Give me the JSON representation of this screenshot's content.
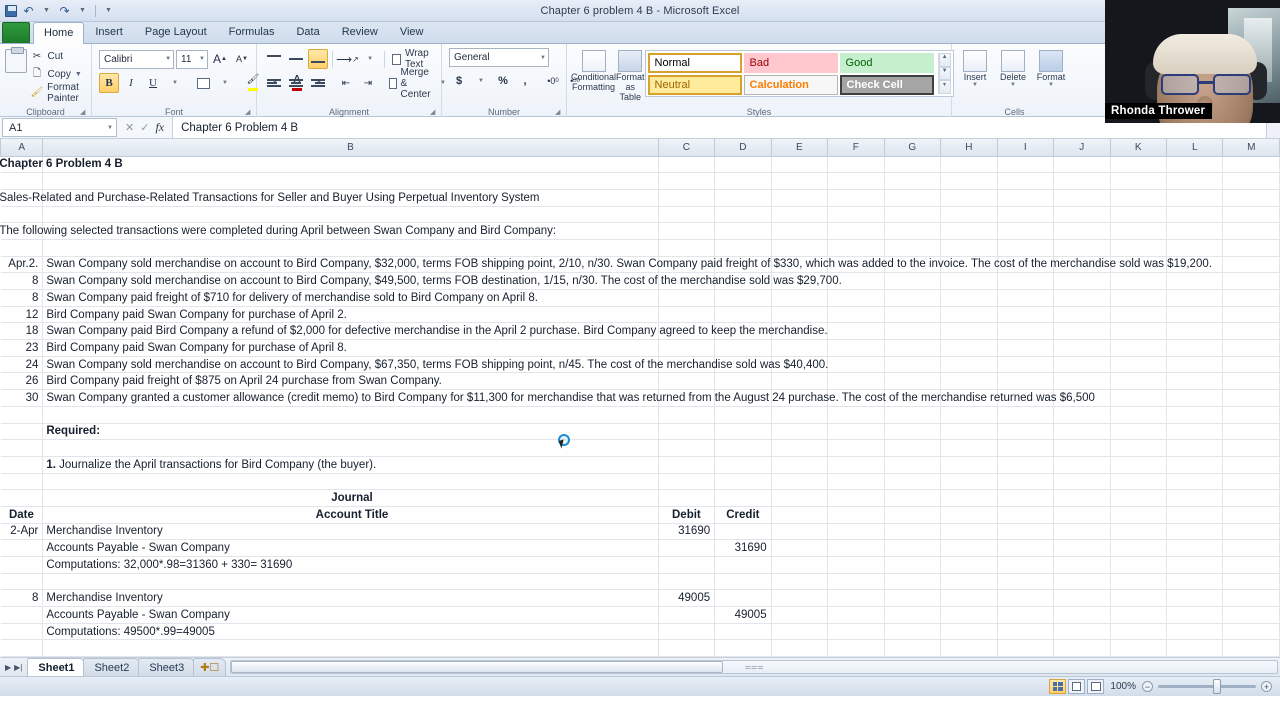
{
  "window": {
    "title": "Chapter 6 problem 4 B  -  Microsoft Excel",
    "quick_access": [
      "save-icon",
      "undo-icon",
      "redo-icon",
      "customize-icon"
    ]
  },
  "ribbon": {
    "tabs": [
      {
        "label": "Home",
        "active": true
      },
      {
        "label": "Insert",
        "active": false
      },
      {
        "label": "Page Layout",
        "active": false
      },
      {
        "label": "Formulas",
        "active": false
      },
      {
        "label": "Data",
        "active": false
      },
      {
        "label": "Review",
        "active": false
      },
      {
        "label": "View",
        "active": false
      }
    ],
    "groups": {
      "clipboard": {
        "label": "Clipboard",
        "paste": "Paste",
        "items": [
          "Cut",
          "Copy",
          "Format Painter"
        ]
      },
      "font": {
        "label": "Font",
        "font_name": "Calibri",
        "font_size": "11",
        "buttons": [
          "grow-font",
          "shrink-font",
          "bold",
          "italic",
          "underline",
          "borders",
          "fill-color",
          "font-color"
        ]
      },
      "alignment": {
        "label": "Alignment",
        "wrap_text": "Wrap Text",
        "merge_center": "Merge & Center"
      },
      "number": {
        "label": "Number",
        "format": "General",
        "buttons": [
          "accounting-format",
          "percent-style",
          "comma-style",
          "increase-decimal",
          "decrease-decimal"
        ]
      },
      "styles": {
        "label": "Styles",
        "conditional_formatting": "Conditional Formatting",
        "format_as_table": "Format as Table",
        "cell_styles": [
          {
            "name": "Normal",
            "bg": "#ffffff",
            "fg": "#000000",
            "border": "#d8a12a"
          },
          {
            "name": "Bad",
            "bg": "#ffc7ce",
            "fg": "#9c0006",
            "border": "#ffc7ce"
          },
          {
            "name": "Good",
            "bg": "#c6efce",
            "fg": "#006100",
            "border": "#c6efce"
          },
          {
            "name": "Neutral",
            "bg": "#ffeb9c",
            "fg": "#9c6500",
            "border": "#d8a12a"
          },
          {
            "name": "Calculation",
            "bg": "#f2f2f2",
            "fg": "#fa7d00",
            "border": "#b0b0b0"
          },
          {
            "name": "Check Cell",
            "bg": "#a5a5a5",
            "fg": "#ffffff",
            "border": "#3f3f3f"
          }
        ]
      },
      "cells": {
        "label": "Cells",
        "items": [
          "Insert",
          "Delete",
          "Format"
        ]
      }
    }
  },
  "formula_bar": {
    "name_box": "A1",
    "value": "Chapter 6 Problem 4 B",
    "fx_label": "fx"
  },
  "grid": {
    "columns": [
      "A",
      "B",
      "C",
      "D",
      "E",
      "F",
      "G",
      "H",
      "I",
      "J",
      "K",
      "L",
      "M"
    ],
    "rows": [
      {
        "a": "",
        "b": "Chapter 6 Problem 4 B",
        "bold": true,
        "spill": true,
        "spill_text": "Chapter 6 Problem 4 B",
        "spill_left": true
      },
      {
        "a": "",
        "b": ""
      },
      {
        "a": "",
        "b": "Sales-Related and Purchase-Related Transactions for Seller and Buyer Using Perpetual Inventory System",
        "spill": true,
        "spill_left": true
      },
      {
        "a": "",
        "b": ""
      },
      {
        "a": "",
        "b": "The following selected transactions were completed during April between Swan Company and Bird Company:",
        "spill": true,
        "spill_left": true
      },
      {
        "a": "",
        "b": ""
      },
      {
        "a": "Apr.2.",
        "b": "Swan Company sold merchandise on account to Bird Company, $32,000, terms FOB shipping point, 2/10, n/30. Swan Company paid freight of $330, which was added to the invoice. The cost of the merchandise sold was $19,200.",
        "spill": true
      },
      {
        "a": "8",
        "b": "Swan Company sold merchandise on account to Bird Company, $49,500, terms FOB destination, 1/15, n/30. The cost of the merchandise sold was $29,700.",
        "spill": true
      },
      {
        "a": "8",
        "b": "Swan Company paid freight of $710 for delivery of merchandise sold to Bird Company on April 8.",
        "spill": true
      },
      {
        "a": "12",
        "b": "Bird Company paid Swan Company for purchase of April 2.",
        "spill": true
      },
      {
        "a": "18",
        "b": "Swan Company paid Bird Company a refund of $2,000 for defective merchandise in the April 2 purchase. Bird Company agreed to keep the merchandise.",
        "spill": true
      },
      {
        "a": "23",
        "b": "Bird Company paid Swan Company for purchase of April 8.",
        "spill": true
      },
      {
        "a": "24",
        "b": "Swan Company sold merchandise on account to Bird Company, $67,350, terms FOB shipping point, n/45. The cost of the merchandise sold was $40,400.",
        "spill": true
      },
      {
        "a": "26",
        "b": "Bird Company paid freight of $875 on April 24 purchase from Swan Company.",
        "spill": true
      },
      {
        "a": "30",
        "b": "Swan Company granted a customer allowance (credit memo) to Bird Company for $11,300 for merchandise that was returned from the August 24 purchase. The cost of the merchandise returned was $6,500",
        "spill": true
      },
      {
        "a": "",
        "b": ""
      },
      {
        "a": "",
        "b": "Required:",
        "bold": true
      },
      {
        "a": "",
        "b": ""
      },
      {
        "a": "",
        "b": "1.  Journalize the April transactions for Bird Company (the buyer).",
        "bold_prefix": "1.",
        "spill": true
      },
      {
        "a": "",
        "b": ""
      },
      {
        "a": "",
        "b": "Journal",
        "bold": true,
        "center": true
      },
      {
        "a": "Date",
        "b": "Account Title",
        "c": "Debit",
        "d": "Credit",
        "bold": true,
        "center": true
      },
      {
        "a": "2-Apr",
        "b": "Merchandise Inventory",
        "c": "31690"
      },
      {
        "a": "",
        "b": "Accounts Payable - Swan Company",
        "indent": true,
        "d": "31690"
      },
      {
        "a": "",
        "b": "Computations:  32,000*.98=31360 + 330= 31690"
      },
      {
        "a": "",
        "b": ""
      },
      {
        "a": "8",
        "b": "Merchandise Inventory",
        "c": "49005"
      },
      {
        "a": "",
        "b": "Accounts Payable - Swan Company",
        "indent": true,
        "d": "49005"
      },
      {
        "a": "",
        "b": "Computations: 49500*.99=49005"
      }
    ]
  },
  "sheet_tabs": {
    "tabs": [
      "Sheet1",
      "Sheet2",
      "Sheet3"
    ],
    "active": "Sheet1",
    "new_sheet_icon": "insert-worksheet-icon"
  },
  "status_bar": {
    "zoom": "100%",
    "views": [
      "normal-view",
      "page-layout-view",
      "page-break-preview"
    ],
    "active_view": "normal-view"
  },
  "webcam": {
    "name": "Rhonda Thrower"
  }
}
